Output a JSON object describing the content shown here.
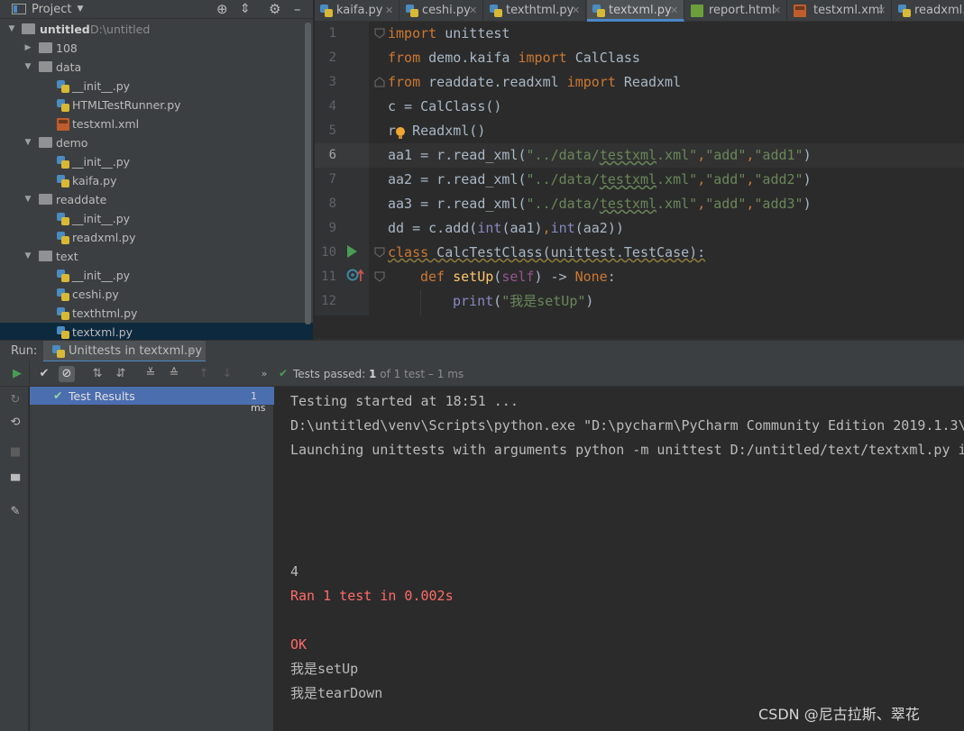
{
  "project_header": {
    "title": "Project"
  },
  "tree": [
    {
      "label": "untitled",
      "path": "D:\\untitled"
    },
    {
      "label": "108"
    },
    {
      "label": "data"
    },
    {
      "label": "__init__.py"
    },
    {
      "label": "HTMLTestRunner.py"
    },
    {
      "label": "testxml.xml"
    },
    {
      "label": "demo"
    },
    {
      "label": "__init__.py"
    },
    {
      "label": "kaifa.py"
    },
    {
      "label": "readdate"
    },
    {
      "label": "__init__.py"
    },
    {
      "label": "readxml.py"
    },
    {
      "label": "text"
    },
    {
      "label": "__init__.py"
    },
    {
      "label": "ceshi.py"
    },
    {
      "label": "texthtml.py"
    },
    {
      "label": "textxml.py"
    }
  ],
  "tabs": [
    {
      "label": "kaifa.py"
    },
    {
      "label": "ceshi.py"
    },
    {
      "label": "texthtml.py"
    },
    {
      "label": "textxml.py"
    },
    {
      "label": "report.html"
    },
    {
      "label": "testxml.xml"
    },
    {
      "label": "readxml.py"
    }
  ],
  "line_numbers": [
    "1",
    "2",
    "3",
    "4",
    "5",
    "6",
    "7",
    "8",
    "9",
    "10",
    "11",
    "12"
  ],
  "code": {
    "l1": {
      "kw": "import",
      "rest": " unittest"
    },
    "l2": {
      "kw": "from",
      "mod": " demo.kaifa ",
      "kw2": "import",
      "rest": " CalClass"
    },
    "l3": {
      "kw": "from",
      "mod": " readdate.readxml ",
      "kw2": "import",
      "rest": " Readxml"
    },
    "l4": {
      "text": "c = CalClass()"
    },
    "l5": {
      "a": "r",
      "b": "= Readxml()"
    },
    "l6": {
      "a": "aa1 = r.read_xml(",
      "s1": "\"../data/",
      "u": "testxml",
      "s2": ".xml\"",
      "c1": ",",
      "s3": "\"add\"",
      "c2": ",",
      "s4": "\"add1\"",
      "e": ")"
    },
    "l7": {
      "a": "aa2 = r.read_xml(",
      "s1": "\"../data/",
      "u": "testxml",
      "s2": ".xml\"",
      "c1": ",",
      "s3": "\"add\"",
      "c2": ",",
      "s4": "\"add2\"",
      "e": ")"
    },
    "l8": {
      "a": "aa3 = r.read_xml(",
      "s1": "\"../data/",
      "u": "testxml",
      "s2": ".xml\"",
      "c1": ",",
      "s3": "\"add\"",
      "c2": ",",
      "s4": "\"add3\"",
      "e": ")"
    },
    "l9": {
      "a": "dd = c.add(",
      "b1": "int",
      "m": "(aa1)",
      "c": ",",
      "b2": "int",
      "e": "(aa2))"
    },
    "l10": {
      "kw": "class",
      "rest": " CalcTestClass(unittest.TestCase):"
    },
    "l11": {
      "kw": "def",
      "fn": " setUp",
      "p1": "(",
      "self": "self",
      "p2": ") -> ",
      "none": "None",
      "e": ":"
    },
    "l12": {
      "fn": "print",
      "p1": "(",
      "s": "\"我是setUp\"",
      "e": ")"
    }
  },
  "run": {
    "label": "Run:",
    "tab": "Unittests in textxml.py",
    "status_prefix": "Tests passed:",
    "status_count": "1",
    "status_suffix": "of 1 test – 1 ms",
    "tree_root": "Test Results",
    "tree_time": "1 ms"
  },
  "console": [
    {
      "text": "Testing started at 18:51 ..."
    },
    {
      "text": "D:\\untitled\\venv\\Scripts\\python.exe \"D:\\pycharm\\PyCharm Community Edition 2019.1.3\\"
    },
    {
      "text": "Launching unittests with arguments python -m unittest D:/untitled/text/textxml.py i"
    },
    {
      "text": "4"
    },
    {
      "text": "Ran 1 test in 0.002s"
    },
    {
      "text": "OK"
    },
    {
      "text": "我是setUp"
    },
    {
      "text": "我是tearDown"
    }
  ],
  "watermark": "CSDN @尼古拉斯、翠花",
  "colors": {
    "accent": "#4a88c7",
    "selection": "#0d293e",
    "passed": "#499c54",
    "error": "#ff6b68"
  }
}
